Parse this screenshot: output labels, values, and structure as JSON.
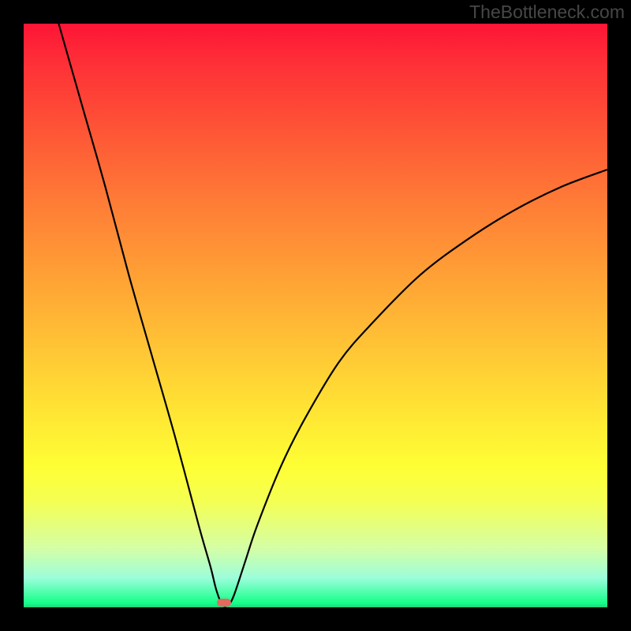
{
  "watermark": "TheBottleneck.com",
  "chart_data": {
    "type": "line",
    "title": "",
    "xlabel": "",
    "ylabel": "",
    "xlim": [
      0,
      100
    ],
    "ylim": [
      0,
      100
    ],
    "grid": false,
    "legend": false,
    "colors": {
      "curve": "#000000",
      "marker": "#e1695e",
      "gradient_top": "#fd1436",
      "gradient_bottom": "#14ff87"
    },
    "series": [
      {
        "name": "bottleneck-curve",
        "x": [
          6,
          10,
          14,
          18,
          22,
          26,
          30,
          32,
          33,
          34,
          35,
          36,
          38,
          40,
          44,
          48,
          54,
          60,
          68,
          76,
          84,
          92,
          100
        ],
        "y": [
          100,
          86,
          72,
          57,
          43,
          29,
          14,
          7,
          3,
          0.5,
          0.4,
          2,
          8,
          14,
          24,
          32,
          42,
          49,
          57,
          63,
          68,
          72,
          75
        ]
      }
    ],
    "marker": {
      "x": 34.3,
      "y": 0.8
    },
    "gradient_stops": [
      {
        "pos": 0,
        "color": "#fd1436"
      },
      {
        "pos": 6,
        "color": "#fe2d37"
      },
      {
        "pos": 18,
        "color": "#fe5436"
      },
      {
        "pos": 31,
        "color": "#ff7d36"
      },
      {
        "pos": 44,
        "color": "#ffa335"
      },
      {
        "pos": 56,
        "color": "#ffc635"
      },
      {
        "pos": 67,
        "color": "#ffe634"
      },
      {
        "pos": 76,
        "color": "#feff34"
      },
      {
        "pos": 82,
        "color": "#f4ff54"
      },
      {
        "pos": 90,
        "color": "#d4fea7"
      },
      {
        "pos": 95,
        "color": "#9bfeda"
      },
      {
        "pos": 99.3,
        "color": "#14ff87"
      },
      {
        "pos": 100,
        "color": "#23d181"
      }
    ]
  }
}
